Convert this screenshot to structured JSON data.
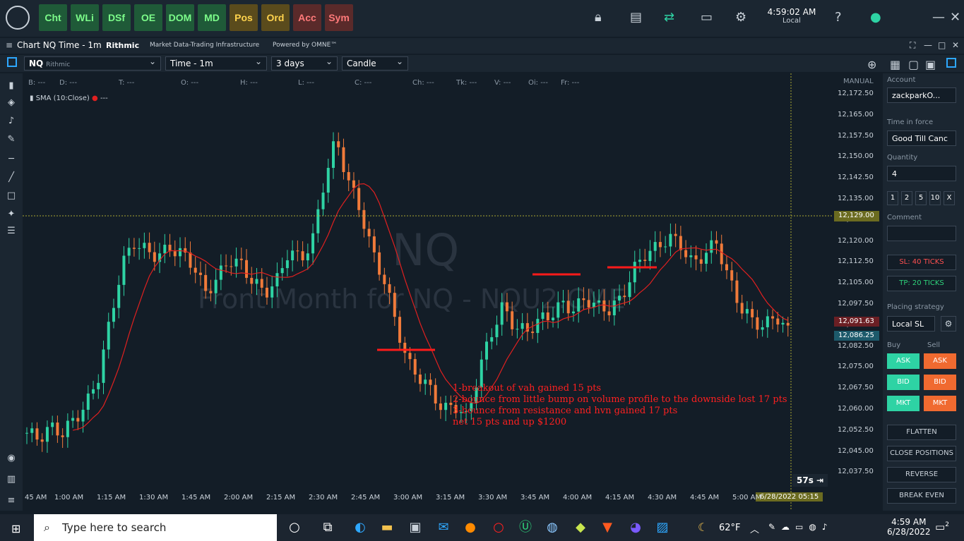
{
  "topbar": {
    "buttons": [
      {
        "label": "Cht",
        "style": "g"
      },
      {
        "label": "WLi",
        "style": "g"
      },
      {
        "label": "DSf",
        "style": "g"
      },
      {
        "label": "OE",
        "style": "g"
      },
      {
        "label": "DOM",
        "style": "g"
      },
      {
        "label": "MD",
        "style": "g"
      },
      {
        "label": "Pos",
        "style": "y"
      },
      {
        "label": "Ord",
        "style": "y"
      },
      {
        "label": "Acc",
        "style": "r"
      },
      {
        "label": "Sym",
        "style": "r"
      }
    ],
    "time": "4:59:02 AM",
    "tz": "Local"
  },
  "titlebar": {
    "title": "Chart NQ Time - 1m",
    "brand": "Rithmic",
    "tagline": "Market Data-Trading Infrastructure",
    "powered": "Powered by OMNE™"
  },
  "toolbar": {
    "symbol": "NQ",
    "provider": "Rithmic",
    "timeframe": "Time - 1m",
    "range": "3 days",
    "style": "Candle"
  },
  "ohlc": [
    "B: ---",
    "D: ---",
    "T: ---",
    "O: ---",
    "H: ---",
    "L: ---",
    "C: ---",
    "Ch: ---",
    "Tk: ---",
    "V: ---",
    "Oi: ---",
    "Fr: ---"
  ],
  "indicator": {
    "label": "SMA (10:Close)",
    "value": "---"
  },
  "watermark": {
    "symbol": "NQ",
    "desc": "Front Month for NQ - NQU2.CME"
  },
  "axis": {
    "mode": "MANUAL",
    "prices": [
      "12,172.50",
      "12,165.00",
      "12,157.50",
      "12,150.00",
      "12,142.50",
      "12,135.00",
      "12,127.50",
      "12,120.00",
      "12,112.50",
      "12,105.00",
      "12,097.50",
      "12,090.00",
      "12,082.50",
      "12,075.00",
      "12,067.50",
      "12,060.00",
      "12,052.50",
      "12,045.00",
      "12,037.50"
    ],
    "crosshair_price": "12,129.00",
    "ask_tag": "12,091.63",
    "last_tag": "12,086.25"
  },
  "times": [
    "45 AM",
    "1:00 AM",
    "1:15 AM",
    "1:30 AM",
    "1:45 AM",
    "2:00 AM",
    "2:15 AM",
    "2:30 AM",
    "2:45 AM",
    "3:00 AM",
    "3:15 AM",
    "3:30 AM",
    "3:45 AM",
    "4:00 AM",
    "4:15 AM",
    "4:30 AM",
    "4:45 AM",
    "5:00 AM"
  ],
  "countdown": "57s",
  "crosshair_time": "6/28/2022 05:15",
  "annotations": [
    "1-breakout of vah gained 15 pts",
    "2-bounce from little bump on volume profile to the downside lost 17 pts",
    "3-bounce from resistance and hvn gained 17 pts",
    "net 15 pts and up $1200"
  ],
  "panel": {
    "account_label": "Account",
    "account": "zackparkO...",
    "tif_label": "Time in force",
    "tif": "Good Till Canc",
    "qty_label": "Quantity",
    "qty": "4",
    "qty_buttons": [
      "1",
      "2",
      "5",
      "10",
      "X"
    ],
    "comment_label": "Comment",
    "sl": "SL: 40 TICKS",
    "tp": "TP: 20 TICKS",
    "strategy_label": "Placing strategy",
    "strategy": "Local SL",
    "buy_label": "Buy",
    "sell_label": "Sell",
    "ask": "ASK",
    "bid": "BID",
    "mkt": "MKT",
    "flatten": "FLATTEN",
    "close": "CLOSE POSITIONS",
    "reverse": "REVERSE",
    "breakeven": "BREAK EVEN"
  },
  "taskbar": {
    "search_placeholder": "Type here to search",
    "temp": "62°F",
    "time": "4:59 AM",
    "date": "6/28/2022",
    "notif": "2"
  },
  "colors": {
    "up": "#2ed3a4",
    "down": "#f07a3a",
    "sma": "#e02020",
    "buy": "#2ed3a4",
    "sell": "#f06a30"
  }
}
